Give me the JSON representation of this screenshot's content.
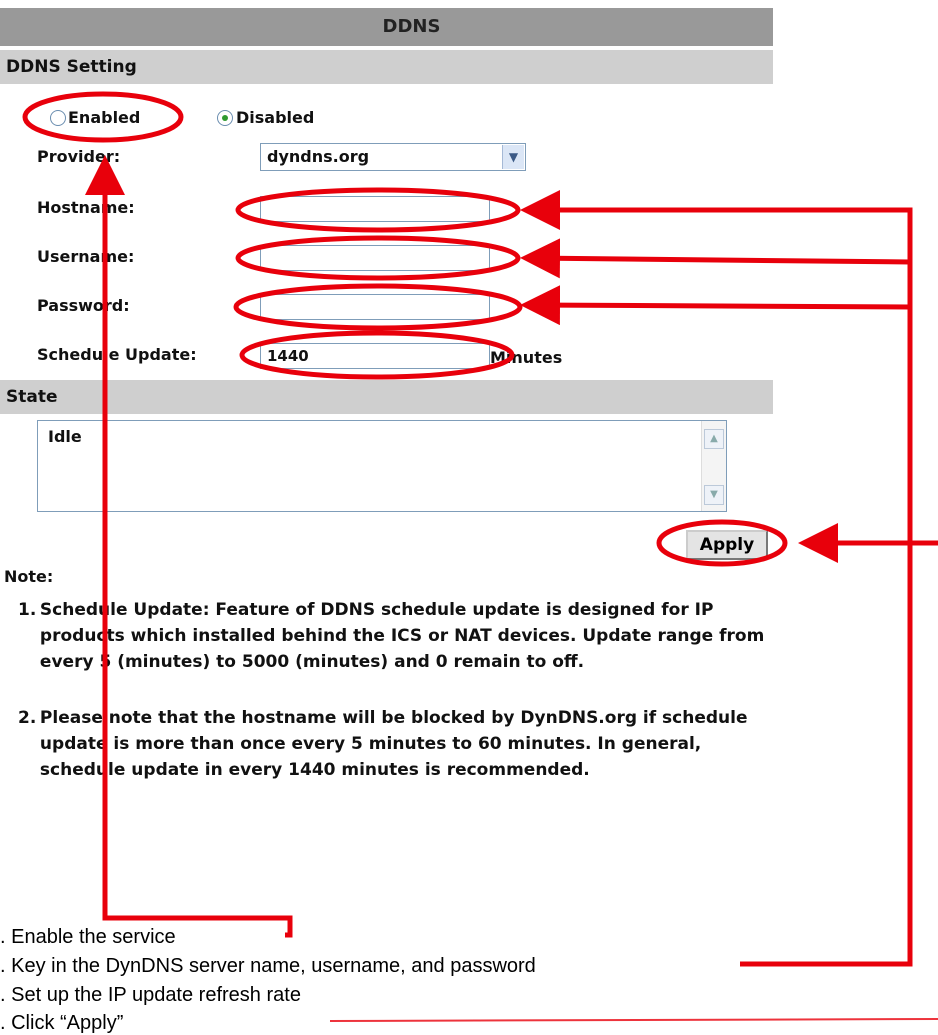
{
  "page_title": "DDNS",
  "ddns_setting": {
    "header": "DDNS Setting",
    "enabled_label": "Enabled",
    "disabled_label": "Disabled",
    "selected_mode": "Disabled",
    "provider_label": "Provider:",
    "provider_value": "dyndns.org",
    "hostname_label": "Hostname:",
    "hostname_value": "",
    "username_label": "Username:",
    "username_value": "",
    "password_label": "Password:",
    "password_value": "",
    "schedule_label": "Schedule Update:",
    "schedule_value": "1440",
    "schedule_unit": "Minutes"
  },
  "state": {
    "header": "State",
    "value": "Idle"
  },
  "apply_label": "Apply",
  "note": {
    "heading": "Note:",
    "items": [
      {
        "num": "1.",
        "text": "Schedule Update: Feature of DDNS schedule update is designed for IP products which installed behind the ICS or NAT devices. Update range from every 5 (minutes) to 5000 (minutes) and 0 remain to off."
      },
      {
        "num": "2.",
        "text": "Please note that the hostname will be blocked by DynDNS.org if schedule update is more than once every 5 minutes to 60 minutes. In general, schedule update in every 1440 minutes is recommended."
      }
    ]
  },
  "steps": [
    ". Enable the service",
    ". Key in the DynDNS server name, username, and password",
    ". Set up the IP update refresh rate",
    ". Click “Apply”"
  ],
  "colors": {
    "title_bar": "#999999",
    "section_bar": "#cfcfcf",
    "annotation": "#e8000b"
  }
}
